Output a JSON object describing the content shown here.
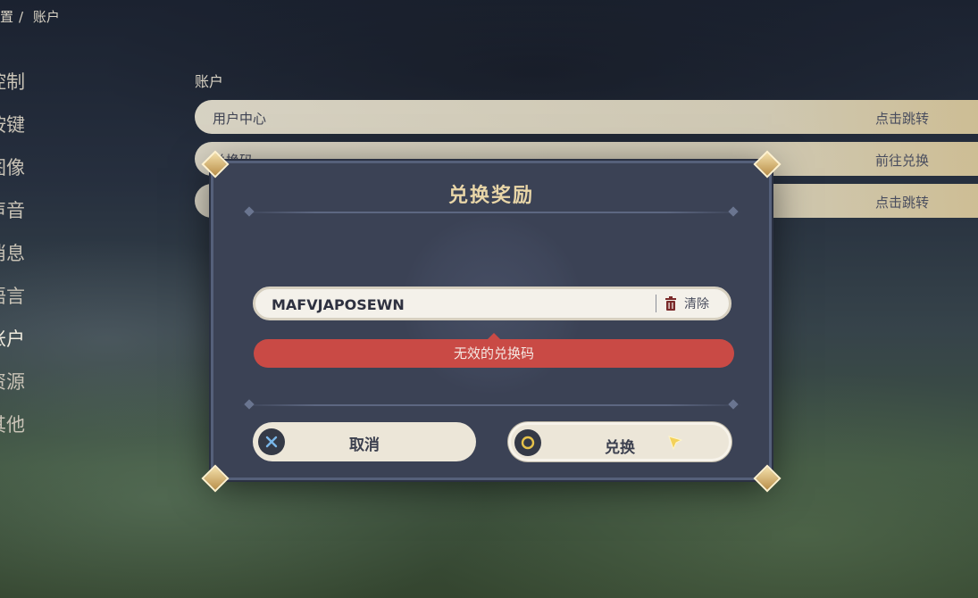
{
  "breadcrumb": {
    "parent": "置",
    "separator": "/",
    "current": "账户"
  },
  "sidebar": {
    "items": [
      {
        "label": "控制"
      },
      {
        "label": "按键"
      },
      {
        "label": "图像"
      },
      {
        "label": "声音"
      },
      {
        "label": "消息"
      },
      {
        "label": "语言"
      },
      {
        "label": "账户"
      },
      {
        "label": "资源"
      },
      {
        "label": "其他"
      }
    ]
  },
  "section": {
    "title": "账户"
  },
  "rows": [
    {
      "label": "用户中心",
      "action": "点击跳转"
    },
    {
      "label": "兑换码",
      "action": "前往兑换"
    },
    {
      "label": "",
      "action": "点击跳转"
    }
  ],
  "dialog": {
    "title": "兑换奖励",
    "code_value": "MAFVJAPOSEWN",
    "clear_label": "清除",
    "error_text": "无效的兑换码",
    "cancel_label": "取消",
    "confirm_label": "兑换"
  },
  "colors": {
    "error": "#c94a45",
    "title_gold": "#e9d6a8",
    "dialog_bg": "#3b4255"
  }
}
